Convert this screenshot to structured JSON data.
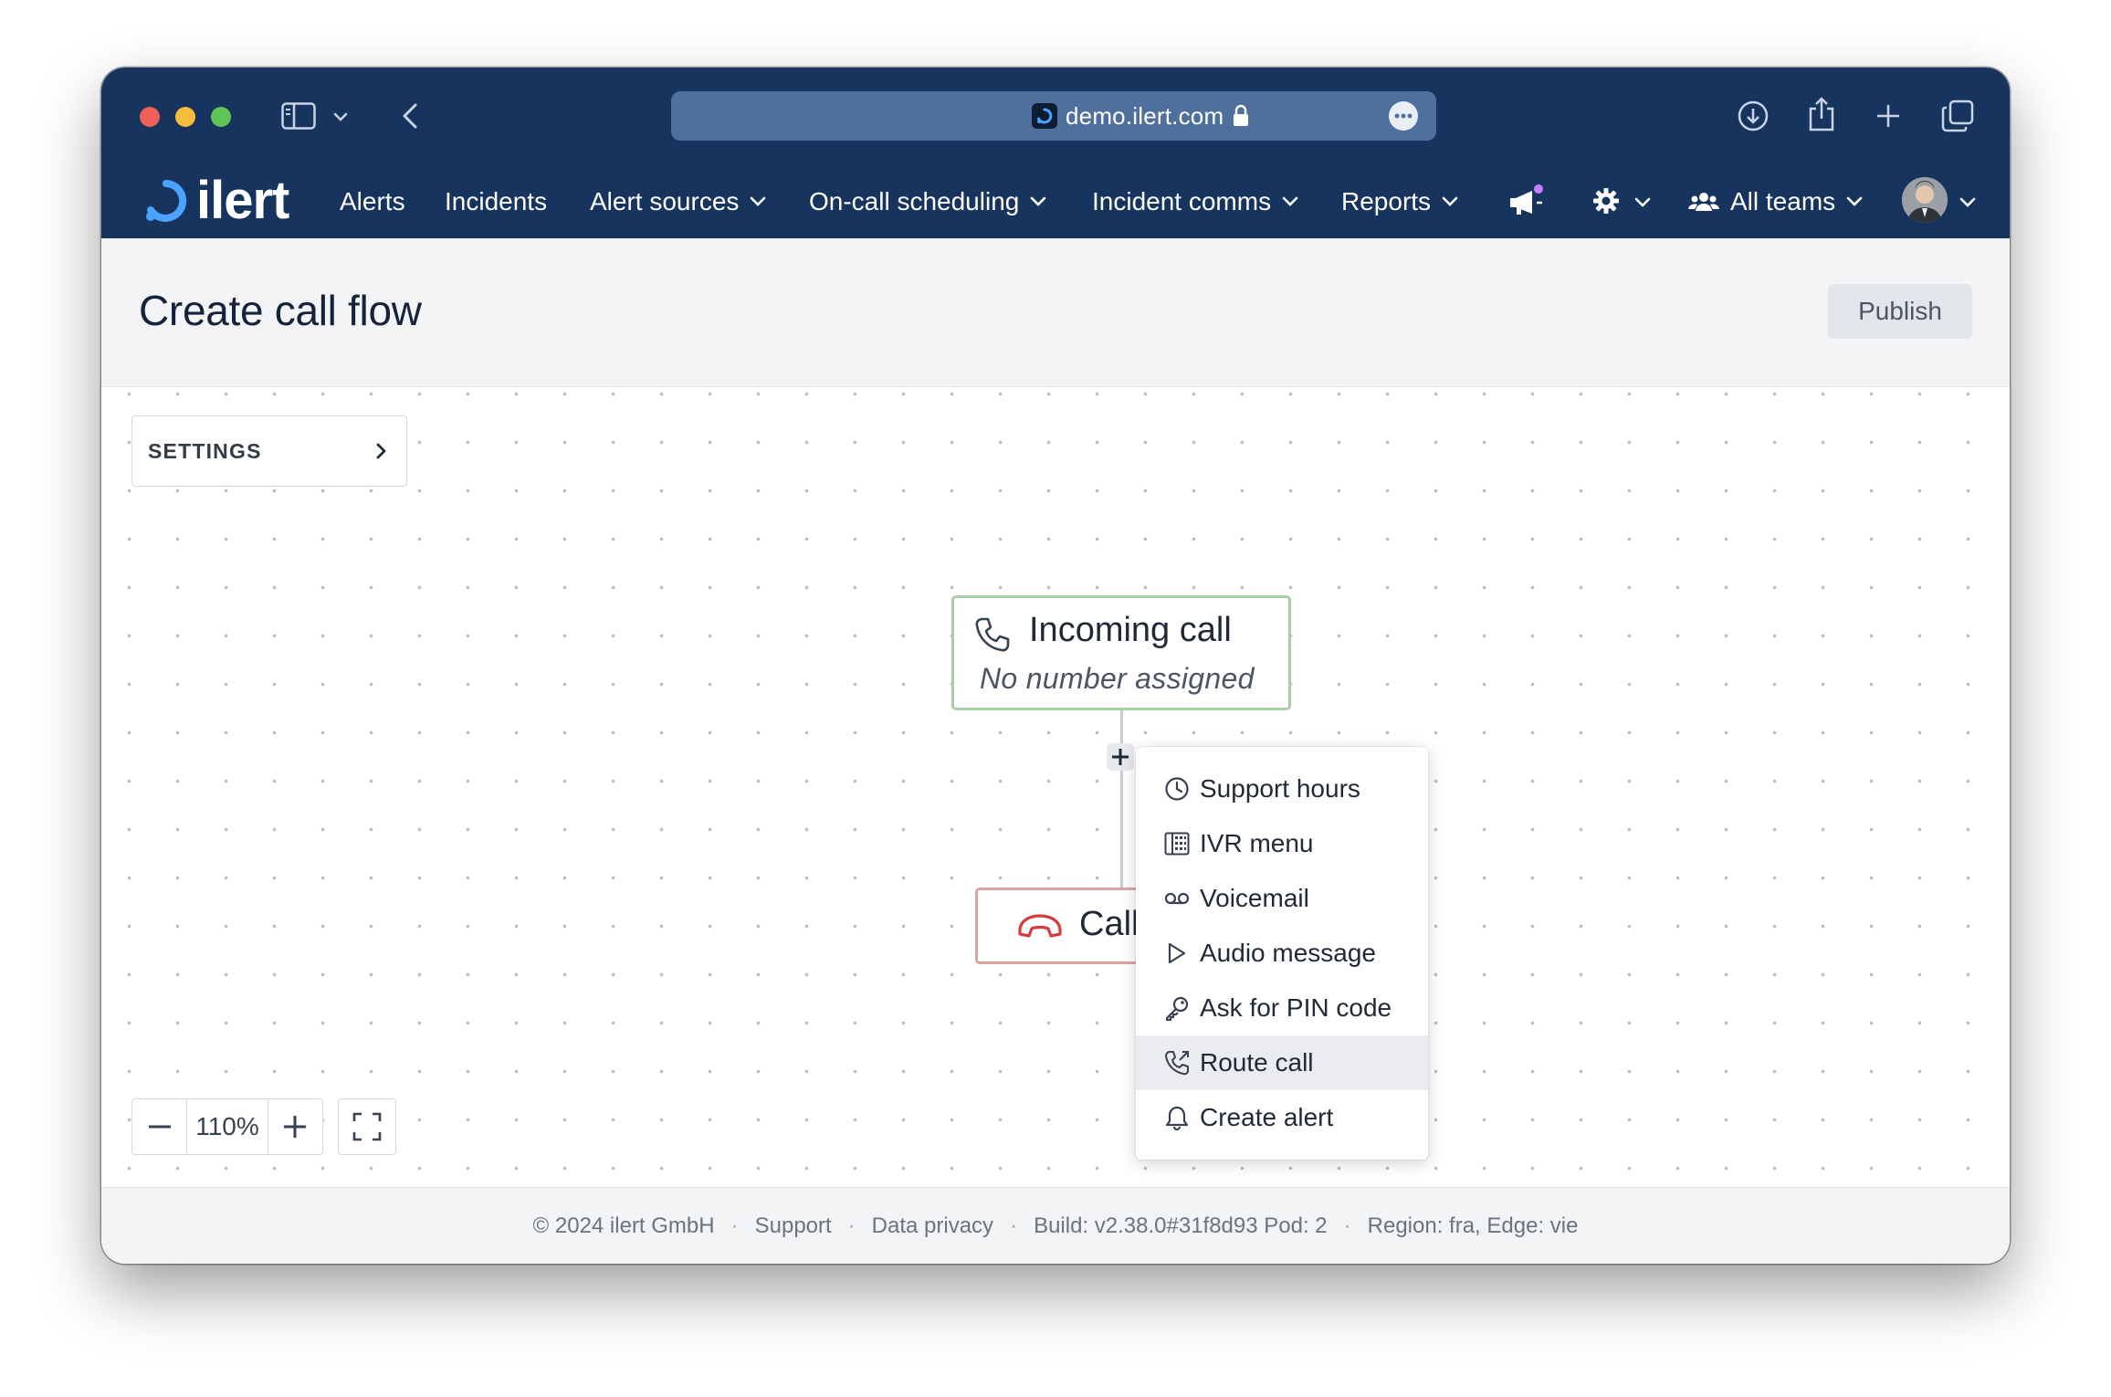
{
  "browser": {
    "url": "demo.ilert.com"
  },
  "nav": {
    "logo": "ilert",
    "items": [
      {
        "label": "Alerts"
      },
      {
        "label": "Incidents"
      },
      {
        "label": "Alert sources"
      },
      {
        "label": "On-call scheduling"
      },
      {
        "label": "Incident comms"
      },
      {
        "label": "Reports"
      }
    ],
    "teams_label": "All teams"
  },
  "header": {
    "title": "Create call flow",
    "publish_label": "Publish"
  },
  "canvas": {
    "settings_label": "SETTINGS",
    "incoming_node": {
      "title": "Incoming call",
      "subtitle": "No number assigned"
    },
    "end_node": {
      "label": "Call"
    },
    "zoom": {
      "value": "110%"
    }
  },
  "dropdown": {
    "items": [
      {
        "label": "Support hours",
        "icon": "clock-icon"
      },
      {
        "label": "IVR menu",
        "icon": "keypad-icon"
      },
      {
        "label": "Voicemail",
        "icon": "voicemail-icon"
      },
      {
        "label": "Audio message",
        "icon": "play-icon"
      },
      {
        "label": "Ask for PIN code",
        "icon": "key-icon"
      },
      {
        "label": "Route call",
        "icon": "phone-forward-icon"
      },
      {
        "label": "Create alert",
        "icon": "bell-icon"
      }
    ],
    "highlighted": "Route call"
  },
  "footer": {
    "copyright": "© 2024 ilert GmbH",
    "support": "Support",
    "privacy": "Data privacy",
    "build": "Build: v2.38.0#31f8d93 Pod: 2",
    "region": "Region: fra, Edge: vie"
  },
  "colors": {
    "nav_bg": "#16345e",
    "incoming_border": "#a9cfa9",
    "end_border": "#e0a3a3",
    "end_icon": "#d43b3b"
  }
}
